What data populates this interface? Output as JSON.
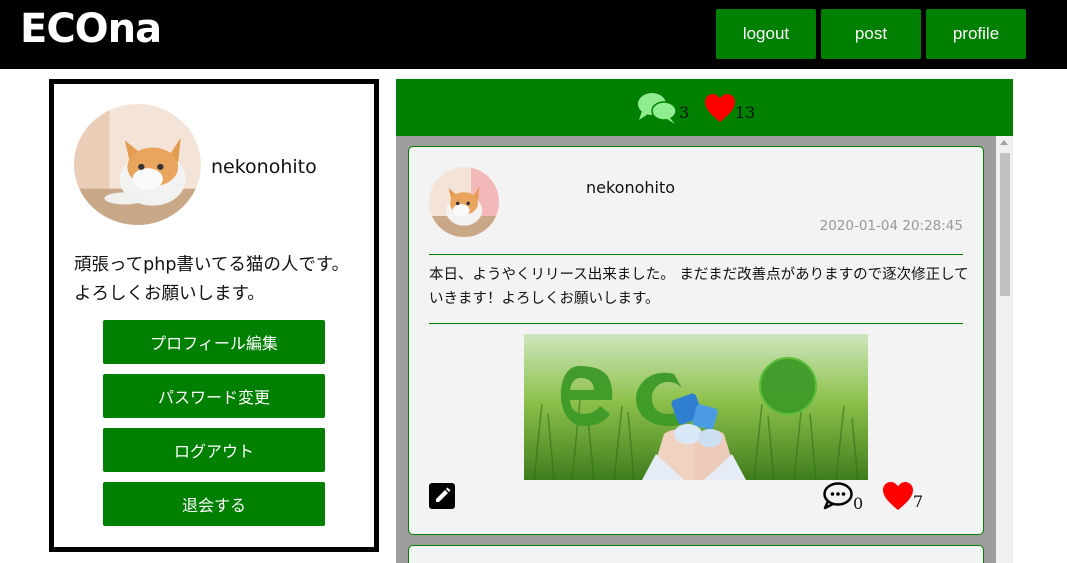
{
  "app": {
    "logo": "ECOna"
  },
  "nav": {
    "logout": "logout",
    "post": "post",
    "profile": "profile"
  },
  "profile": {
    "username": "nekonohito",
    "bio": "頑張ってphp書いてる猫の人です。 よろしくお願いします。",
    "buttons": {
      "edit_profile": "プロフィール編集",
      "change_password": "パスワード変更",
      "logout": "ログアウト",
      "withdraw": "退会する"
    }
  },
  "header_stats": {
    "comment_count": "3",
    "like_count": "13"
  },
  "post": {
    "username": "nekonohito",
    "timestamp": "2020-01-04 20:28:45",
    "body": "本日、ようやくリリース出来ました。 まだまだ改善点がありますので逐次修正していきます！よろしくお願いします。",
    "comment_count": "0",
    "like_count": "7"
  },
  "icons": {
    "header_comment": "comments-icon",
    "header_like": "heart-icon",
    "edit": "pencil-icon",
    "comment": "comment-icon",
    "like": "heart-icon"
  },
  "colors": {
    "accent": "#008000",
    "topbar": "#000000",
    "heart": "#ff0000",
    "comment_light": "#90ee90"
  }
}
